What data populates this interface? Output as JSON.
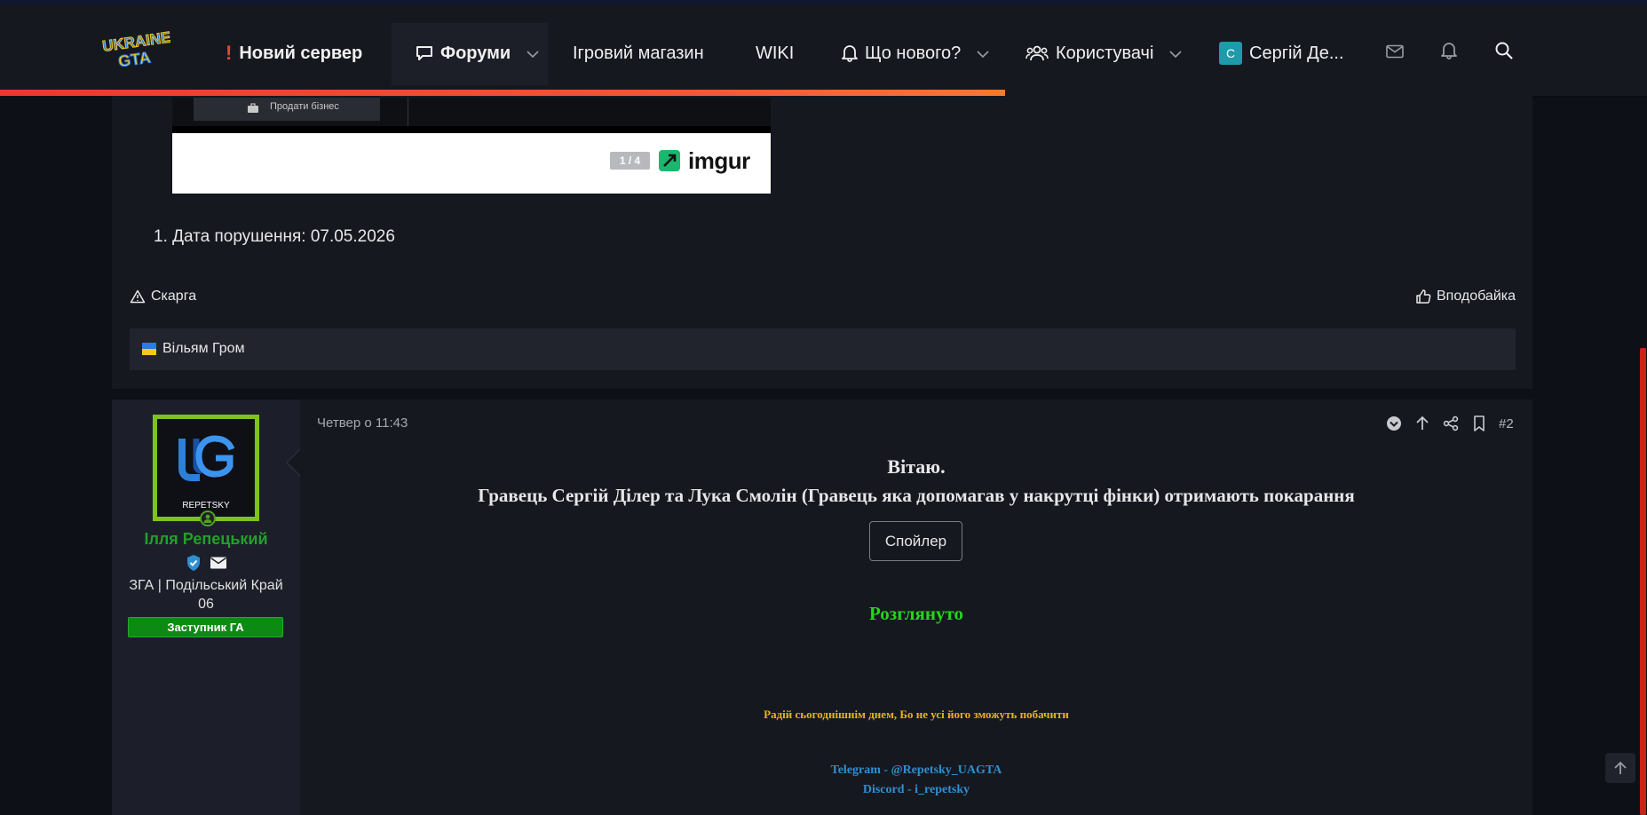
{
  "header": {
    "logo_alt": "UKRAINE GTA",
    "nav": {
      "new_server": "Новий сервер",
      "forums": "Форуми",
      "shop": "Ігровий магазин",
      "wiki": "WIKI",
      "whats_new": "Що нового?",
      "users": "Користувачі",
      "account_initial": "С",
      "account_name": "Сергій Де..."
    },
    "reading_progress": 0.61
  },
  "post1": {
    "imgur": {
      "menu_item": "Продати бізнес",
      "counter": "1 / 4",
      "brand": "imgur"
    },
    "list_item": "1. Дата порушення: 07.05.2026",
    "report_label": "Скарга",
    "like_label": "Вподобайка",
    "liked_by": "Вільям Гром"
  },
  "post2": {
    "author": {
      "avatar_text": "REPETSKY",
      "name": "Ілля Репецький",
      "title": "ЗГА | Подільський Край 06",
      "banner": "Заступник ГА"
    },
    "date": "Четвер о 11:43",
    "number": "#2",
    "greeting": "Вітаю.",
    "verdict": "Гравець Сергій Ділер та Лука Смолін (Гравець яка допомагав у накрутці фінки) отримають покарання",
    "spoiler_label": "Спойлер",
    "status": "Розглянуто",
    "signature": {
      "quote": "Радій сьогоднішнім днем, Бо не усі його зможуть побачити",
      "telegram": "Telegram - @Repetsky_UAGTA",
      "discord": "Discord - i_repetsky"
    }
  },
  "colors": {
    "accent_orange": "#f05a32",
    "status_green": "#22d818",
    "signature_gold": "#e9b31c",
    "link_blue": "#2f8fd0",
    "username_green": "#22a02a"
  }
}
